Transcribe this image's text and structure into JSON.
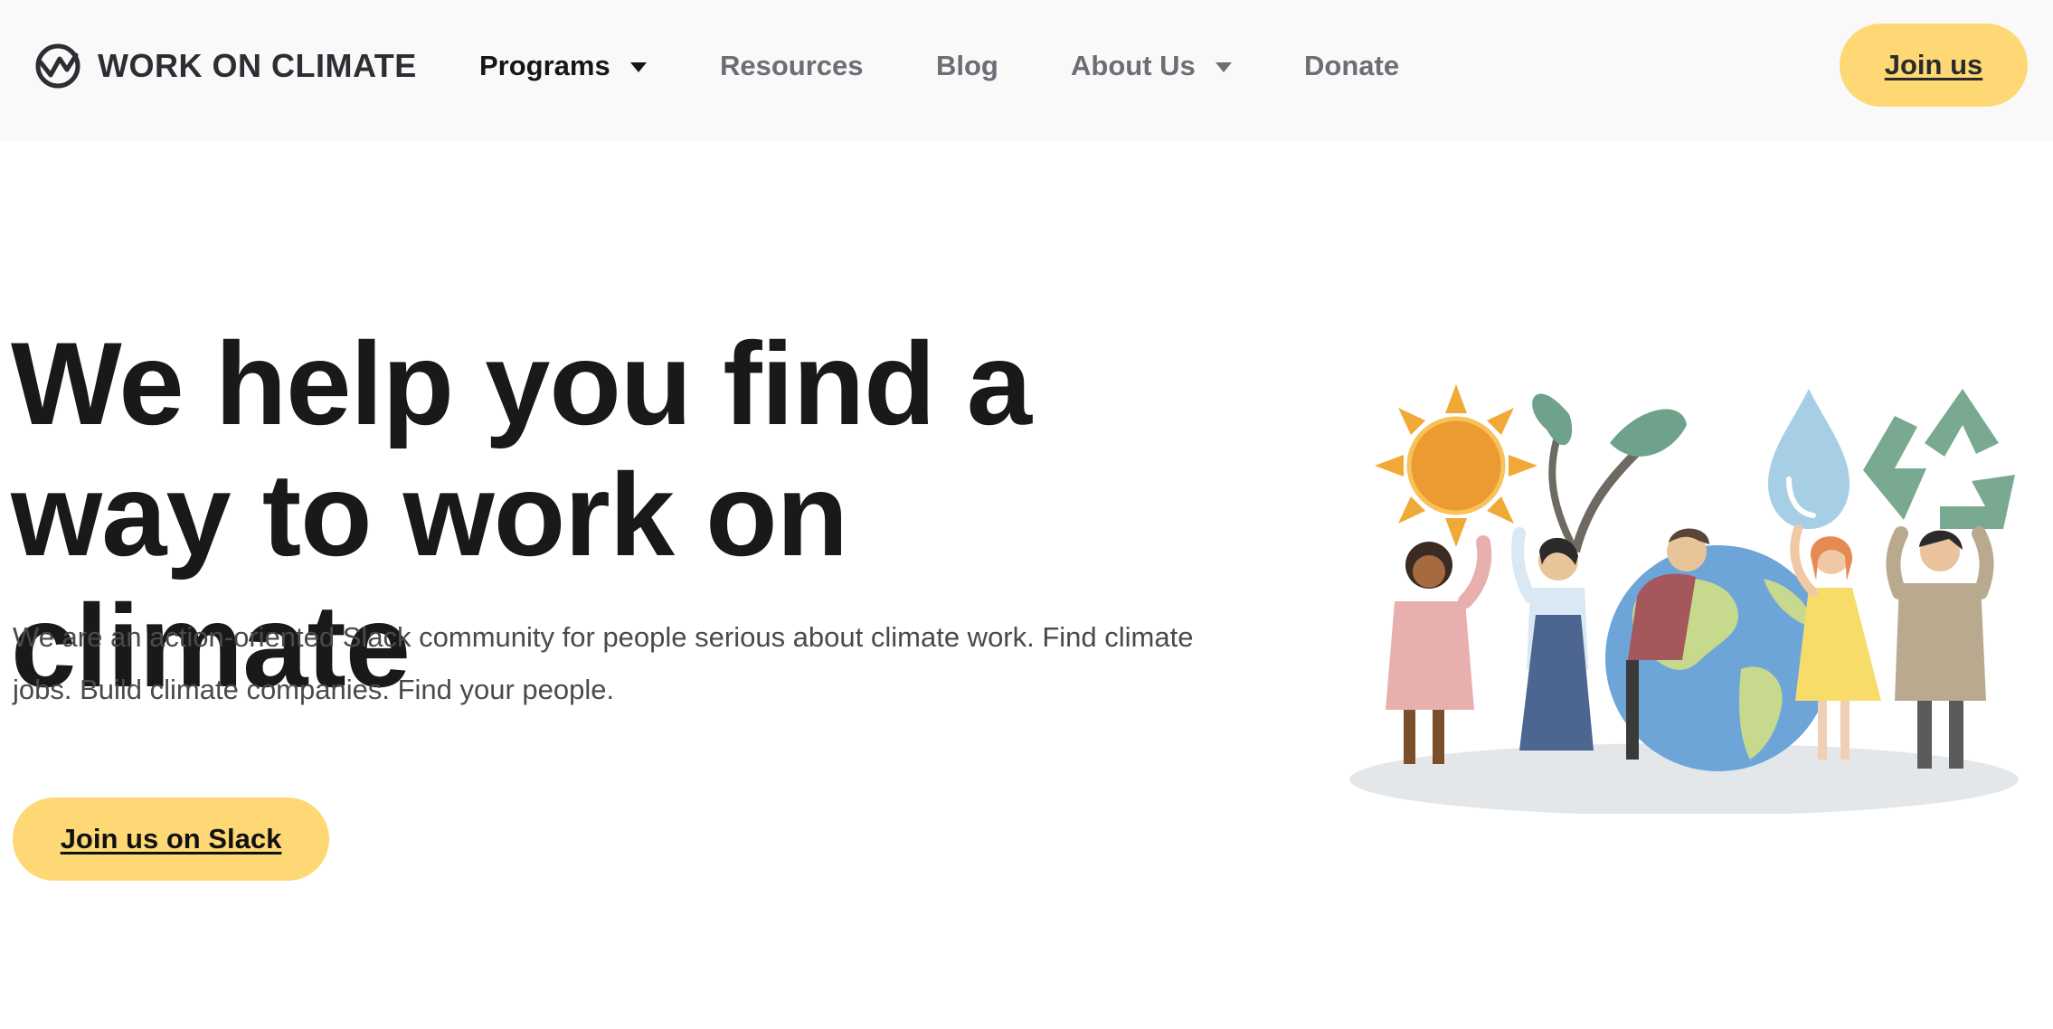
{
  "header": {
    "logo_text": "WORK ON CLIMATE",
    "logo_icon": "climate-logo-icon",
    "nav": [
      {
        "label": "Programs",
        "has_dropdown": true,
        "active": true
      },
      {
        "label": "Resources",
        "has_dropdown": false
      },
      {
        "label": "Blog",
        "has_dropdown": false
      },
      {
        "label": "About Us",
        "has_dropdown": true
      },
      {
        "label": "Donate",
        "has_dropdown": false
      }
    ],
    "cta_label": "Join us"
  },
  "hero": {
    "title_line1": "We help you find a",
    "title_line2": "way to work on climate",
    "subtitle": "We are an action-oriented Slack community for people serious about climate work. Find climate jobs. Build climate companies. Find your people.",
    "cta_label": "Join us on Slack",
    "illustration": "people-holding-climate-symbols-illustration"
  },
  "colors": {
    "header_bg": "#f9f9f9",
    "button_bg": "#fdd874",
    "nav_text": "#6b6e74",
    "nav_active": "#161616",
    "title_text": "#19191a"
  }
}
